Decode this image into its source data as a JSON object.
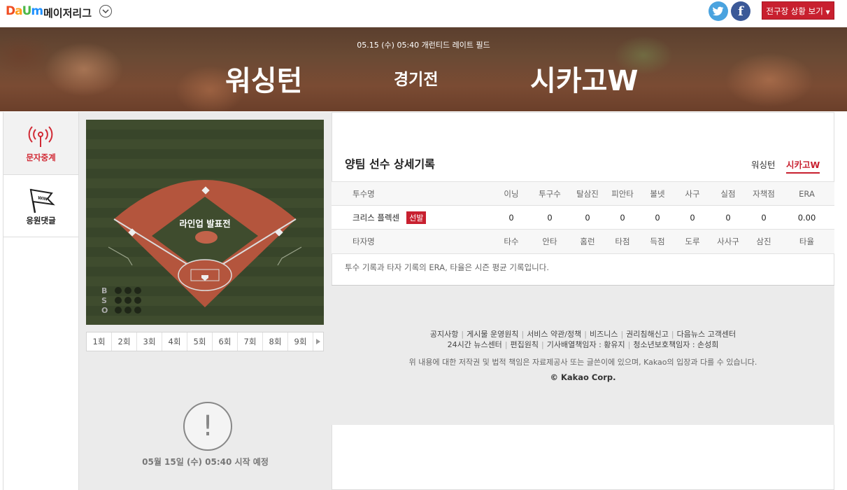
{
  "header": {
    "logo_letters": [
      "D",
      "a",
      "U",
      "m"
    ],
    "league": "메이저리그",
    "all_games_button": "전구장 상황 보기"
  },
  "banner": {
    "game_info": "05.15 (수) 05:40 개런티드 레이트 필드",
    "home_team": "워싱턴",
    "vs_label": "경기전",
    "away_team": "시카고W"
  },
  "nav": {
    "items": [
      {
        "label": "문자중계"
      },
      {
        "label": "응원댓글"
      }
    ]
  },
  "field": {
    "status_text": "라인업 발표전",
    "count_labels": [
      "B",
      "S",
      "O"
    ],
    "win_flag_text": "WIN"
  },
  "innings": [
    "1회",
    "2회",
    "3회",
    "4회",
    "5회",
    "6회",
    "7회",
    "8회",
    "9회"
  ],
  "notice": {
    "icon": "!",
    "text": "05월 15일 (수) 05:40 시작 예정"
  },
  "records": {
    "title": "양팀 선수 상세기록",
    "team_tabs": [
      "워싱턴",
      "시카고W"
    ],
    "pitcher_headers": [
      "투수명",
      "이닝",
      "투구수",
      "탈삼진",
      "피안타",
      "볼넷",
      "사구",
      "실점",
      "자책점",
      "ERA"
    ],
    "pitchers": [
      {
        "name": "크리스 플렉센",
        "badge": "선발",
        "stats": [
          "0",
          "0",
          "0",
          "0",
          "0",
          "0",
          "0",
          "0",
          "0.00"
        ]
      }
    ],
    "batter_headers": [
      "타자명",
      "타수",
      "안타",
      "홈런",
      "타점",
      "득점",
      "도루",
      "사사구",
      "삼진",
      "타율"
    ],
    "note": "투수 기록과 타자 기록의 ERA, 타율은 시즌 평균 기록입니다."
  },
  "footer": {
    "links1": [
      "공지사항",
      "게시물 운영원칙",
      "서비스 약관/정책",
      "비즈니스",
      "권리침해신고",
      "다음뉴스 고객센터"
    ],
    "links2": [
      "24시간 뉴스센터",
      "편집원칙",
      "기사배열책임자 : 황유지",
      "청소년보호책임자 : 손성희"
    ],
    "disclaimer": "위 내용에 대한 저작권 및 법적 책임은 자료제공사 또는 글쓴이에 있으며, Kakao의 입장과 다를 수 있습니다.",
    "copyright": "© Kakao Corp."
  },
  "colors": {
    "accent": "#c8202f",
    "twitter": "#4aa3df",
    "facebook": "#3b5998",
    "logo": [
      "#f04e23",
      "#ff9f1c",
      "#4cb848",
      "#1e90ff"
    ]
  }
}
